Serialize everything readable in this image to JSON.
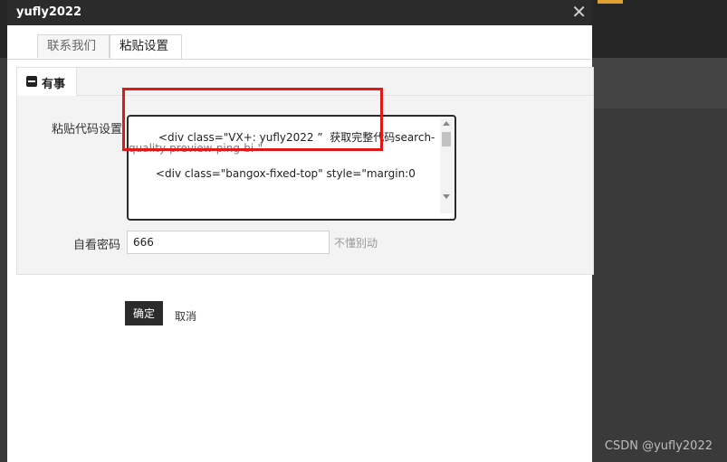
{
  "window": {
    "title": "yufly2022",
    "close_icon": "close-icon"
  },
  "tabs": [
    {
      "label": "联系我们"
    },
    {
      "label": "粘贴设置"
    }
  ],
  "panel": {
    "subtab_label": "有事",
    "fields": {
      "code_label": "粘贴代码设置",
      "code_line1": "<div class=\"VX+: yufly2022 ”  获取完整代码search-",
      "code_line2": "quality-preview-ping-bi-\"",
      "code_line3": "<div class=\"bangox-fixed-top\" style=\"margin:0",
      "password_label": "自看密码",
      "password_value": "666",
      "hint": "不懂别动"
    }
  },
  "buttons": {
    "ok": "确定",
    "cancel": "取消"
  },
  "watermark": "CSDN @yufly2022",
  "colors": {
    "highlight": "#e01818",
    "title_bar": "#2b2b2b"
  }
}
